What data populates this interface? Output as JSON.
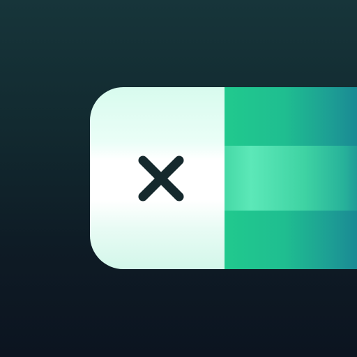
{
  "icon": {
    "name": "close-icon",
    "glyph": "×",
    "color": "#15292d"
  },
  "colors": {
    "background_top": "#17353a",
    "background_bottom": "#0c1420",
    "panel_light": "#ffffff",
    "stripe_green": "#21c98e",
    "stripe_highlight": "#5ce8b8",
    "stripe_teal": "#1a8a94"
  }
}
